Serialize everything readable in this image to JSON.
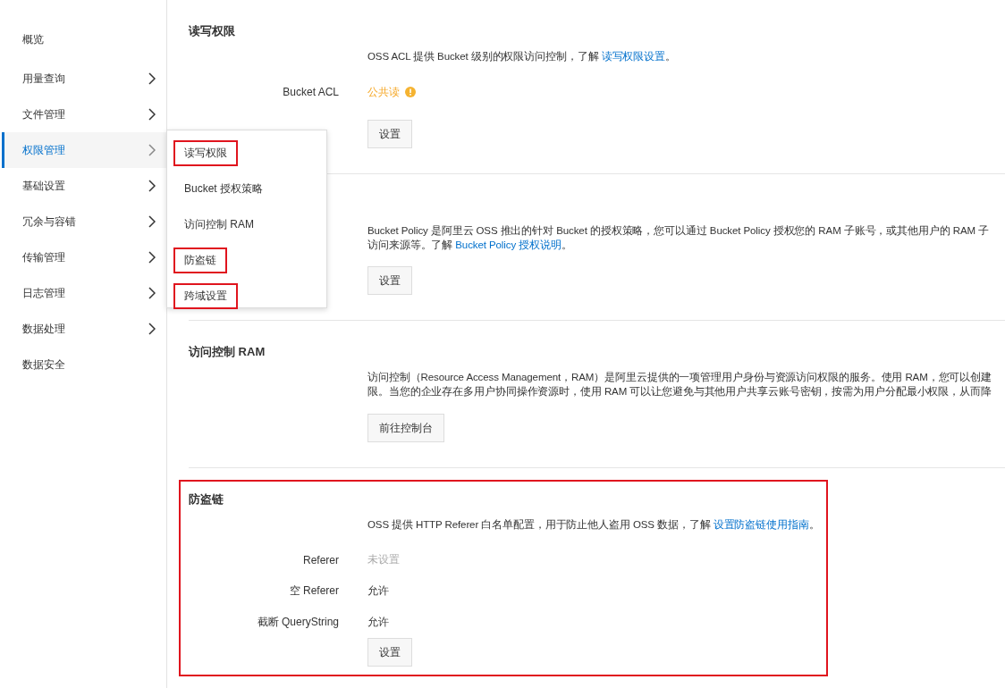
{
  "sidebar": {
    "items": [
      {
        "label": "概览",
        "has_submenu": false,
        "selected": false
      },
      {
        "label": "用量查询",
        "has_submenu": true,
        "selected": false
      },
      {
        "label": "文件管理",
        "has_submenu": true,
        "selected": false
      },
      {
        "label": "权限管理",
        "has_submenu": true,
        "selected": true
      },
      {
        "label": "基础设置",
        "has_submenu": true,
        "selected": false
      },
      {
        "label": "冗余与容错",
        "has_submenu": true,
        "selected": false
      },
      {
        "label": "传输管理",
        "has_submenu": true,
        "selected": false
      },
      {
        "label": "日志管理",
        "has_submenu": true,
        "selected": false
      },
      {
        "label": "数据处理",
        "has_submenu": true,
        "selected": false
      },
      {
        "label": "数据安全",
        "has_submenu": false,
        "selected": false
      }
    ]
  },
  "popup_menu": {
    "items": [
      {
        "label": "读写权限",
        "highlighted": true
      },
      {
        "label": "Bucket 授权策略",
        "highlighted": false
      },
      {
        "label": "访问控制 RAM",
        "highlighted": false
      },
      {
        "label": "防盗链",
        "highlighted": true
      },
      {
        "label": "跨域设置",
        "highlighted": true
      }
    ]
  },
  "sections": [
    {
      "heading": "读写权限",
      "highlighted": false,
      "description": [
        {
          "parts": [
            {
              "kind": "text",
              "text": "OSS ACL 提供 Bucket 级别的权限访问控制，了解 "
            },
            {
              "kind": "link",
              "text": "读写权限设置"
            },
            {
              "kind": "text",
              "text": "。"
            }
          ]
        }
      ],
      "fields": [
        {
          "label": "Bucket ACL",
          "value": "公共读",
          "kind": "warning"
        }
      ],
      "button": "设置"
    },
    {
      "highlighted": false,
      "description": [
        {
          "parts": [
            {
              "kind": "text",
              "text": "Bucket Policy 是阿里云 OSS 推出的针对 Bucket 的授权策略，您可以通过 Bucket Policy 授权您的 RAM 子账号，或其他用户的 RAM 子"
            }
          ]
        },
        {
          "parts": [
            {
              "kind": "text",
              "text": "访问来源等。了解 "
            },
            {
              "kind": "link",
              "text": "Bucket Policy 授权说明"
            },
            {
              "kind": "text",
              "text": "。"
            }
          ]
        }
      ],
      "button": "设置"
    },
    {
      "heading": "访问控制 RAM",
      "highlighted": false,
      "description": [
        {
          "parts": [
            {
              "kind": "text",
              "text": "访问控制（Resource Access Management，RAM）是阿里云提供的一项管理用户身份与资源访问权限的服务。使用 RAM，您可以创建"
            }
          ]
        },
        {
          "parts": [
            {
              "kind": "text",
              "text": "限。当您的企业存在多用户协同操作资源时，使用 RAM 可以让您避免与其他用户共享云账号密钥，按需为用户分配最小权限，从而降"
            }
          ]
        }
      ],
      "button": "前往控制台"
    },
    {
      "heading": "防盗链",
      "highlighted": true,
      "description": [
        {
          "parts": [
            {
              "kind": "text",
              "text": "OSS 提供 HTTP Referer 白名单配置，用于防止他人盗用 OSS 数据，了解 "
            },
            {
              "kind": "link",
              "text": "设置防盗链使用指南"
            },
            {
              "kind": "text",
              "text": "。"
            }
          ]
        }
      ],
      "fields": [
        {
          "label": "Referer",
          "value": "未设置",
          "kind": "muted"
        },
        {
          "label": "空 Referer",
          "value": "允许",
          "kind": "plain"
        },
        {
          "label": "截断 QueryString",
          "value": "允许",
          "kind": "plain"
        }
      ],
      "button": "设置"
    }
  ]
}
